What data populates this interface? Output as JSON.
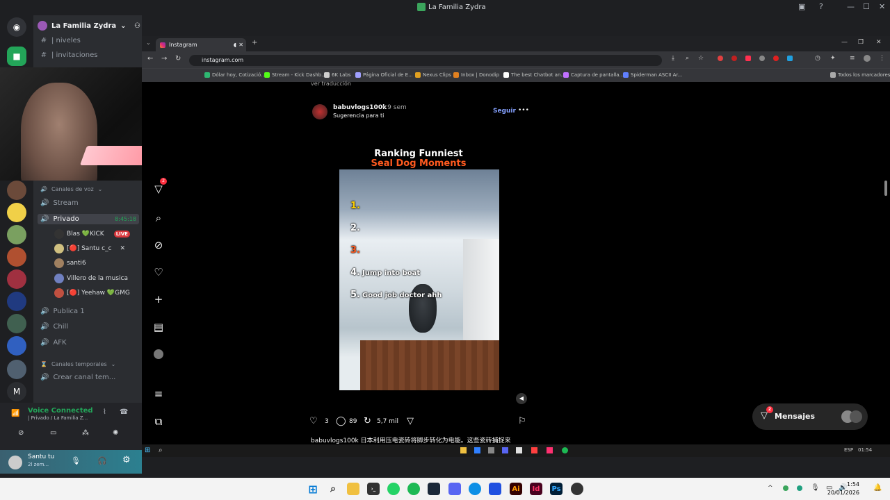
{
  "window": {
    "title": "La Familia Zydra"
  },
  "discord": {
    "server_name": "La Familia Zydra",
    "channels_top": [
      "| niveles",
      "| invitaciones"
    ],
    "voice_category": "Canales de voz",
    "voice_channels": [
      "Stream",
      "Privado",
      "Publica 1",
      "Chill",
      "AFK"
    ],
    "privado_time": "8:45:18",
    "users": [
      {
        "name": "Blas 💚KICK",
        "live": "LIVE"
      },
      {
        "name": "[🔴] Santu c_c"
      },
      {
        "name": "santi6"
      },
      {
        "name": "Villero de la musica"
      },
      {
        "name": "[🔴] Yeehaw 💚GMG"
      }
    ],
    "temp_category": "Canales temporales",
    "temp_channel": "Crear canal tem...",
    "voice_status": "Voice Connected",
    "voice_sub": "| Privado / La Familia Z...",
    "user_name": "Santu tu",
    "user_status": "2l zem..."
  },
  "browser": {
    "tab_title": "Instagram",
    "url": "instagram.com",
    "bookmarks": [
      "Dólar hoy, Cotizació...",
      "Stream - Kick Dashb...",
      "6K Labs",
      "Página Oficial de E...",
      "Nexus Clips",
      "Inbox | Donodip",
      "The best Chatbot an...",
      "Captura de pantalla...",
      "Spiderman ASCII Ar...",
      "Todos los marcadores"
    ]
  },
  "instagram": {
    "translation_hint": "ver traducción",
    "notif_badge": "2",
    "post": {
      "username": "babuvlogs100k",
      "time": "• 9 sem",
      "subtitle": "Sugerencia para ti",
      "follow": "Seguir",
      "more": "•••",
      "video_title_line1": "Ranking Funniest",
      "video_title_line2": "Seal Dog Moments",
      "ranks": [
        {
          "n": "1.",
          "text": "",
          "color": "#ffd000"
        },
        {
          "n": "2.",
          "text": "",
          "color": "#ffffff"
        },
        {
          "n": "3.",
          "text": "",
          "color": "#ff5a1f"
        },
        {
          "n": "4.",
          "text": "Jump into boat",
          "color": "#ffffff"
        },
        {
          "n": "5.",
          "text": "Good job doctor ahh",
          "color": "#ffffff"
        }
      ],
      "likes": "3",
      "comments": "89",
      "reposts": "5,7 mil",
      "caption": "babuvlogs100k 日本利用压电瓷砖将脚步转化为电能。这些瓷砖捕捉来"
    },
    "messages_label": "Mensajes",
    "messages_badge": "2"
  },
  "taskbar": {
    "time": "1:54",
    "date": "20/01/2026"
  },
  "inner_clock": {
    "lang": "ESP",
    "time": "01:54"
  }
}
